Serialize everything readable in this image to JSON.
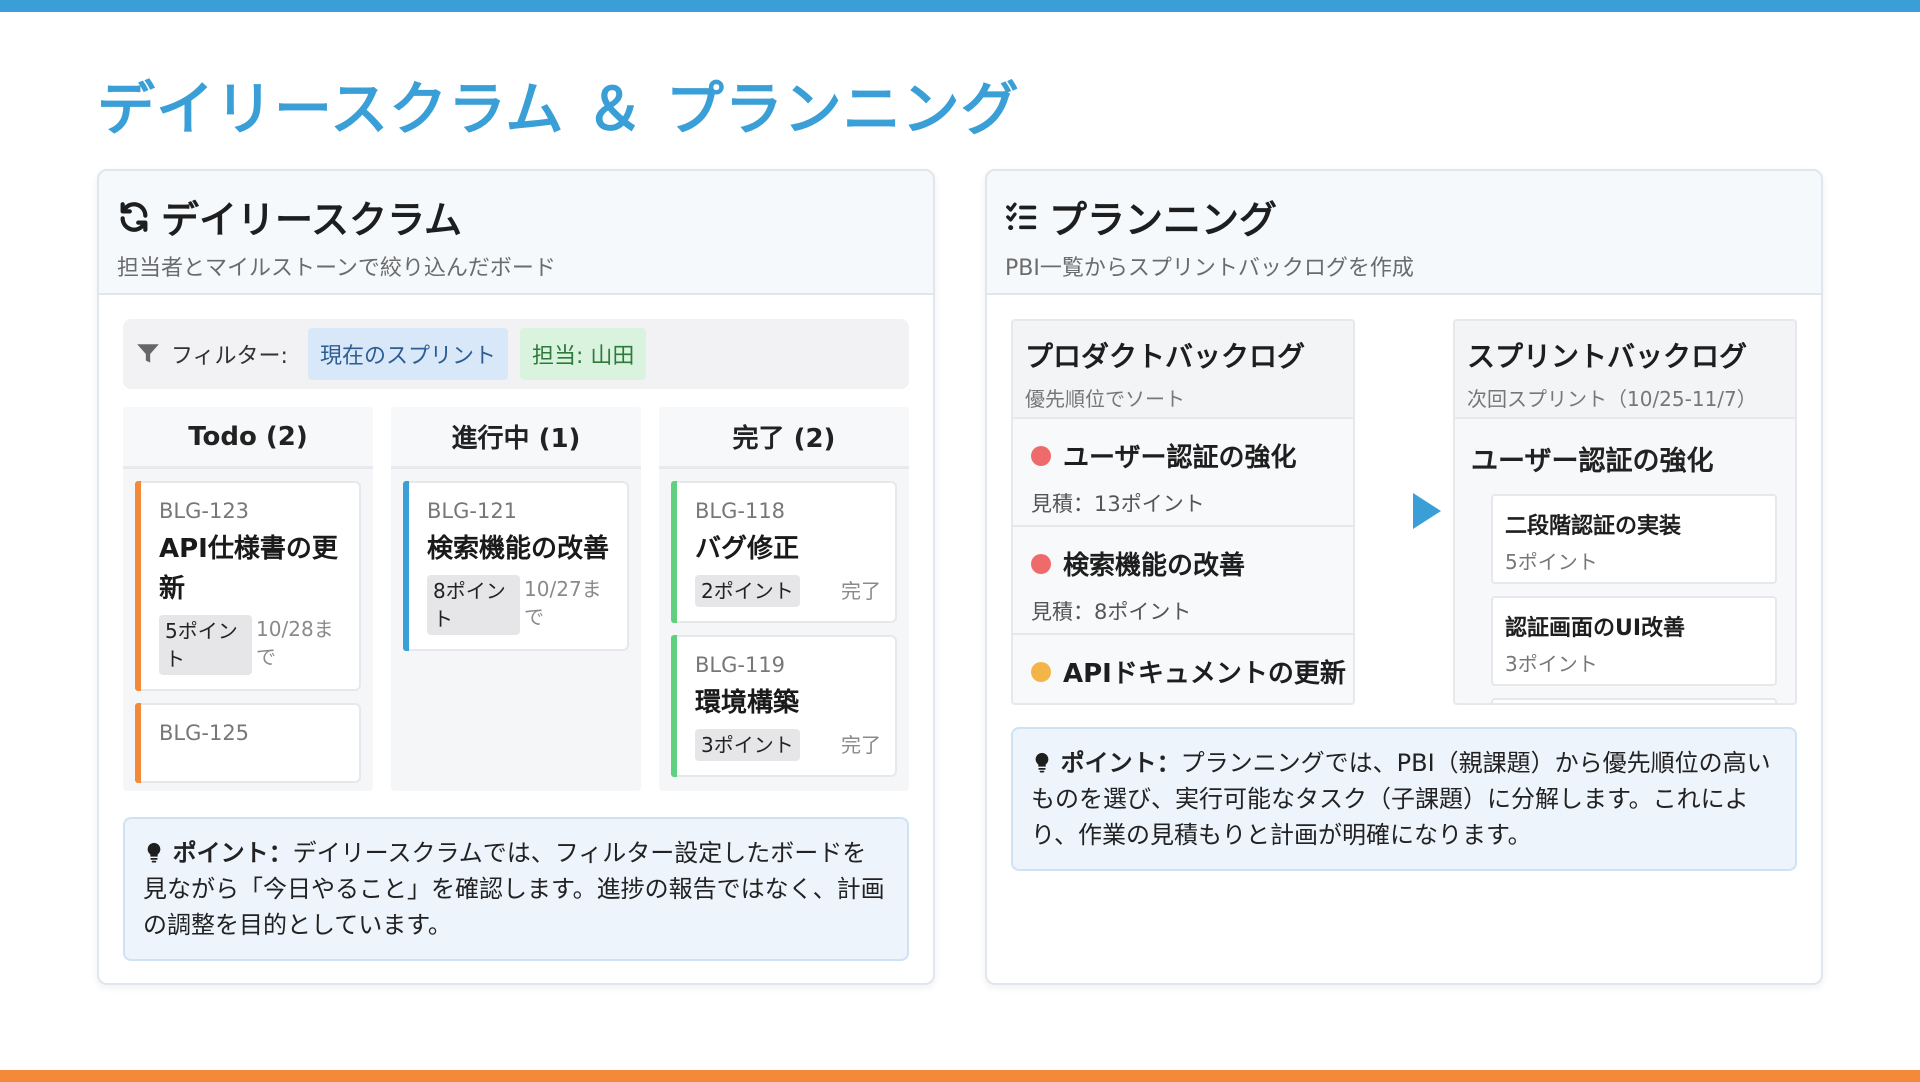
{
  "page": {
    "title": "デイリースクラム ＆ プランニング"
  },
  "colors": {
    "accent_blue": "#3a9fd6",
    "accent_orange": "#f5893a",
    "status_green": "#5fcf80",
    "priority_red": "#ef6b6b",
    "priority_yellow": "#f4b548"
  },
  "daily": {
    "icon": "sync-icon",
    "title": "デイリースクラム",
    "subtitle": "担当者とマイルストーンで絞り込んだボード",
    "filter": {
      "icon": "filter-icon",
      "label": "フィルター:",
      "chips": [
        "現在のスプリント",
        "担当: 山田"
      ]
    },
    "columns": [
      {
        "header": "Todo (2)",
        "cards": [
          {
            "id": "BLG-123",
            "title": "API仕様書の更新",
            "points": "5ポイント",
            "due": "10/28まで"
          },
          {
            "id": "BLG-125",
            "title": "",
            "points": "",
            "due": ""
          }
        ]
      },
      {
        "header": "進行中 (1)",
        "cards": [
          {
            "id": "BLG-121",
            "title": "検索機能の改善",
            "points": "8ポイント",
            "due": "10/27まで"
          }
        ]
      },
      {
        "header": "完了 (2)",
        "cards": [
          {
            "id": "BLG-118",
            "title": "バグ修正",
            "points": "2ポイント",
            "status": "完了"
          },
          {
            "id": "BLG-119",
            "title": "環境構築",
            "points": "3ポイント",
            "status": "完了"
          }
        ]
      }
    ],
    "tip": {
      "icon": "lightbulb-icon",
      "label": "ポイント：",
      "text": "デイリースクラムでは、フィルター設定したボードを見ながら「今日やること」を確認します。進捗の報告ではなく、計画の調整を目的としています。"
    }
  },
  "planning": {
    "icon": "checklist-icon",
    "title": "プランニング",
    "subtitle": "PBI一覧からスプリントバックログを作成",
    "product_backlog": {
      "title": "プロダクトバックログ",
      "subtitle": "優先順位でソート",
      "items": [
        {
          "title": "ユーザー認証の強化",
          "estimate": "見積：13ポイント",
          "priority": "high"
        },
        {
          "title": "検索機能の改善",
          "estimate": "見積：8ポイント",
          "priority": "high"
        },
        {
          "title": "APIドキュメントの更新",
          "estimate": "",
          "priority": "medium"
        }
      ]
    },
    "arrow_icon": "play-arrow-icon",
    "sprint_backlog": {
      "title": "スプリントバックログ",
      "subtitle": "次回スプリント（10/25-11/7）",
      "parent": "ユーザー認証の強化",
      "children": [
        {
          "title": "二段階認証の実装",
          "points": "5ポイント"
        },
        {
          "title": "認証画面のUI改善",
          "points": "3ポイント"
        }
      ]
    },
    "tip": {
      "icon": "lightbulb-icon",
      "label": "ポイント：",
      "text": "プランニングでは、PBI（親課題）から優先順位の高いものを選び、実行可能なタスク（子課題）に分解します。これにより、作業の見積もりと計画が明確になります。"
    }
  }
}
